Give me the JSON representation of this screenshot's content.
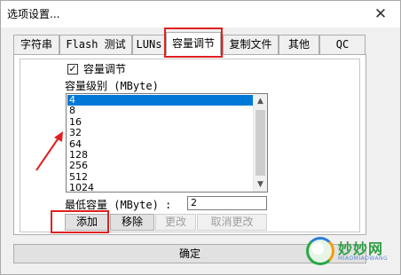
{
  "window": {
    "title": "选项设置..."
  },
  "tabs": [
    {
      "label": "字符串"
    },
    {
      "label": "Flash 测试"
    },
    {
      "label": "LUNs"
    },
    {
      "label": "容量调节",
      "active": true
    },
    {
      "label": "复制文件"
    },
    {
      "label": "其他"
    },
    {
      "label": "QC"
    }
  ],
  "capacity": {
    "enable_label": "容量调节",
    "enabled": true,
    "list_label": "容量级别 (MByte)",
    "items": [
      "4",
      "8",
      "16",
      "32",
      "64",
      "128",
      "256",
      "512",
      "1024"
    ],
    "selected": "4",
    "min_label": "最低容量 (MByte) :",
    "min_value": "2"
  },
  "buttons": {
    "add": "添加",
    "remove": "移除",
    "modify": "更改",
    "cancel_modify": "取消更改",
    "ok": "确定"
  },
  "icons": {
    "close": "close-icon",
    "check": "checkmark-icon",
    "scroll_up": "chevron-up-icon",
    "scroll_down": "chevron-down-icon"
  },
  "colors": {
    "selection": "#0078d7",
    "highlight_box": "#e02020"
  },
  "watermark": {
    "brand": "妙妙网",
    "sub": "MIAOMIAOWANG"
  }
}
